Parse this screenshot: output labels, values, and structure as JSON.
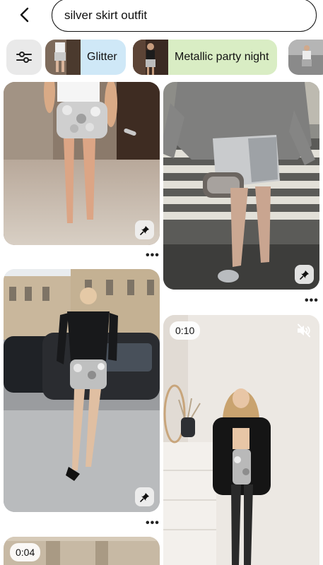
{
  "search": {
    "query": "silver skirt outfit"
  },
  "chips": [
    {
      "label": "Glitter",
      "color": "#cfe8f7"
    },
    {
      "label": "Metallic party night",
      "color": "#d9edc4"
    }
  ],
  "pins": [
    {
      "name": "pin-sequin-skirt-white-top",
      "has_pin_badge": true
    },
    {
      "name": "pin-metallic-skirt-grey-sweater",
      "has_pin_badge": true
    },
    {
      "name": "pin-sequin-skirt-black-shirt",
      "has_pin_badge": true
    },
    {
      "name": "pin-video-blazer-outfit",
      "duration": "0:10",
      "muted": true
    },
    {
      "name": "pin-video-building",
      "duration": "0:04"
    }
  ],
  "more_label": "•••",
  "colors": {
    "accent": "#111111",
    "chip_filter_bg": "#e9e9e9",
    "glitter_chip": "#cfe8f7",
    "party_chip": "#d9edc4"
  }
}
